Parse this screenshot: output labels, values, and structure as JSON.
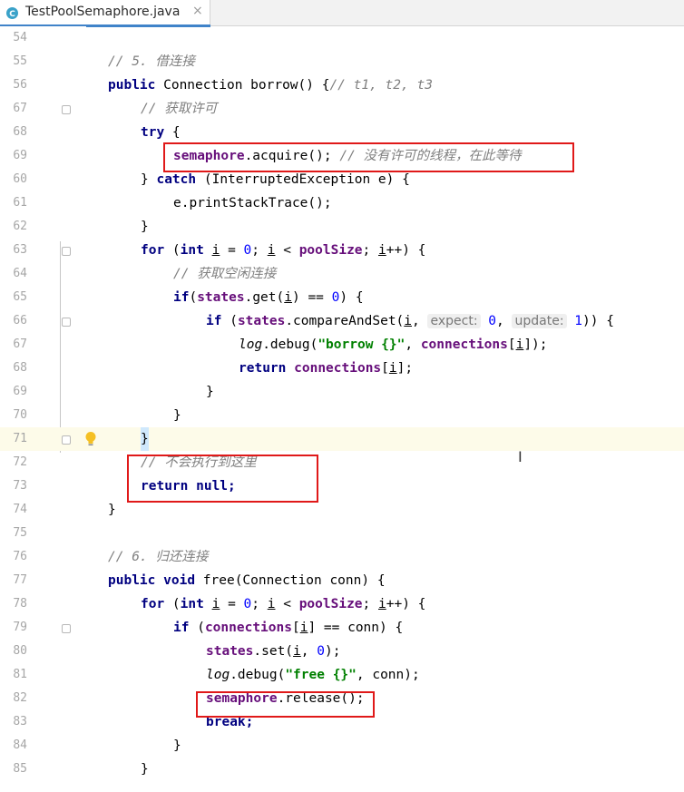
{
  "tab": {
    "title": "TestPoolSemaphore.java",
    "close": "×",
    "icon": "java-class-icon"
  },
  "lines": [
    {
      "n": "54",
      "code": ""
    },
    {
      "n": "55",
      "code": "// 5. 借连接"
    },
    {
      "n": "56",
      "code": "public Connection borrow() {// t1, t2, t3"
    },
    {
      "n": "67",
      "code": "// 获取许可"
    },
    {
      "n": "68",
      "code": "try {"
    },
    {
      "n": "69",
      "code": "semaphore.acquire(); // 没有许可的线程，在此等待"
    },
    {
      "n": "60",
      "code": "} catch (InterruptedException e) {"
    },
    {
      "n": "61",
      "code": "e.printStackTrace();"
    },
    {
      "n": "62",
      "code": "}"
    },
    {
      "n": "63",
      "code": "for (int i = 0; i < poolSize; i++) {"
    },
    {
      "n": "64",
      "code": "// 获取空闲连接"
    },
    {
      "n": "65",
      "code": "if(states.get(i) == 0) {"
    },
    {
      "n": "66",
      "code": "if (states.compareAndSet(i, expect: 0, update: 1)) {"
    },
    {
      "n": "67",
      "code": "log.debug(\"borrow {}\", connections[i]);"
    },
    {
      "n": "68",
      "code": "return connections[i];"
    },
    {
      "n": "69",
      "code": "}"
    },
    {
      "n": "70",
      "code": "}"
    },
    {
      "n": "71",
      "code": "}"
    },
    {
      "n": "72",
      "code": "// 不会执行到这里"
    },
    {
      "n": "73",
      "code": "return null;"
    },
    {
      "n": "74",
      "code": "}"
    },
    {
      "n": "75",
      "code": ""
    },
    {
      "n": "76",
      "code": "// 6. 归还连接"
    },
    {
      "n": "77",
      "code": "public void free(Connection conn) {"
    },
    {
      "n": "78",
      "code": "for (int i = 0; i < poolSize; i++) {"
    },
    {
      "n": "79",
      "code": "if (connections[i] == conn) {"
    },
    {
      "n": "80",
      "code": "states.set(i, 0);"
    },
    {
      "n": "81",
      "code": "log.debug(\"free {}\", conn);"
    },
    {
      "n": "82",
      "code": "semaphore.release();"
    },
    {
      "n": "83",
      "code": "break;"
    },
    {
      "n": "84",
      "code": "}"
    },
    {
      "n": "85",
      "code": "}"
    }
  ],
  "hints": {
    "expect": "expect:",
    "update": "update:"
  },
  "colors": {
    "highlight_box": "#e01919",
    "keyword": "#000080",
    "field": "#660e7a",
    "comment": "#808080",
    "string": "#008000",
    "number": "#0000ff"
  }
}
